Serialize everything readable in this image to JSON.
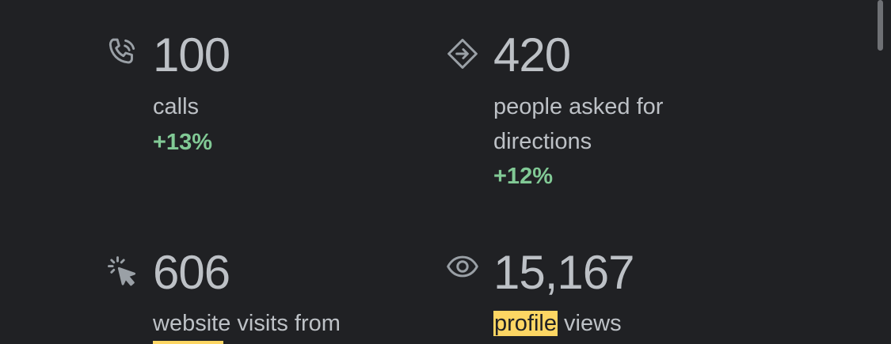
{
  "stats": [
    {
      "icon": "phone-icon",
      "value": "100",
      "label_lines": [
        "calls"
      ],
      "change": "+13%"
    },
    {
      "icon": "directions-icon",
      "value": "420",
      "label_lines": [
        "people asked for",
        "directions"
      ],
      "change": "+12%"
    },
    {
      "icon": "cursor-click-icon",
      "value": "606",
      "label_lines": [
        "website visits from"
      ]
    },
    {
      "icon": "eye-icon",
      "value": "15,167",
      "label_highlight": "profile",
      "label_rest": " views"
    }
  ],
  "colors": {
    "background": "#202124",
    "text": "#bdc1c6",
    "positive": "#81c995",
    "highlight": "#fdd663"
  }
}
